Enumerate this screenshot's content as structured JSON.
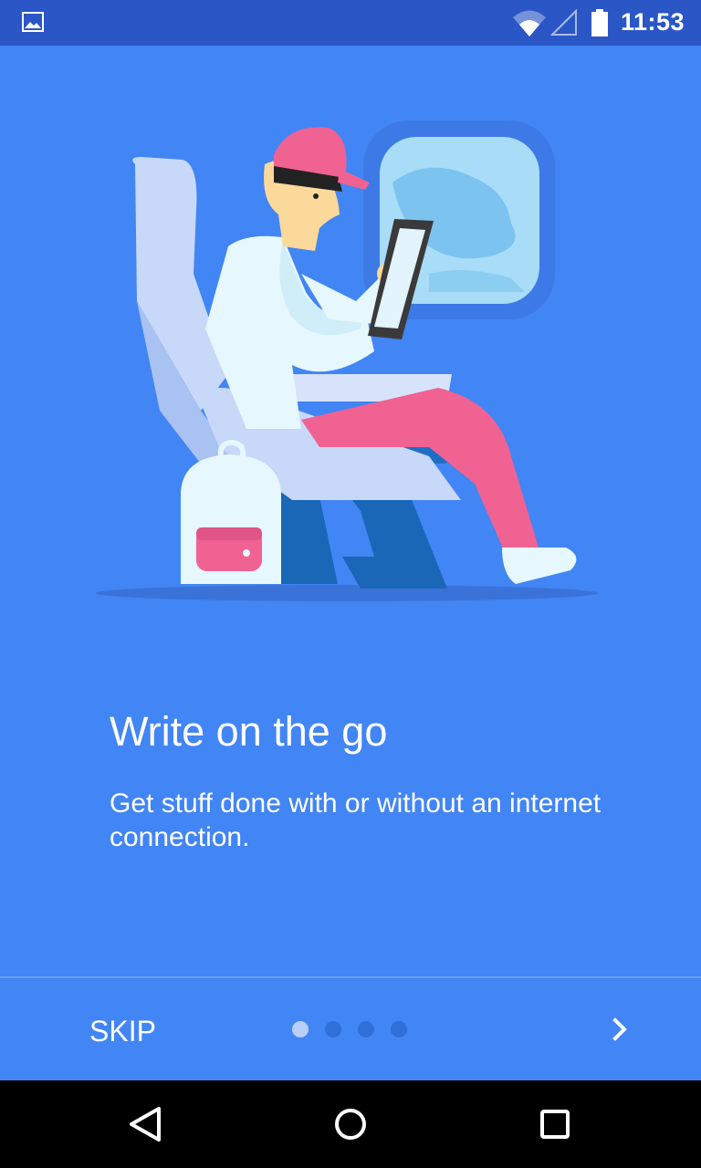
{
  "status_bar": {
    "time": "11:53",
    "icons": [
      "gallery-icon",
      "wifi-icon",
      "cell-signal-icon",
      "battery-icon"
    ]
  },
  "onboarding": {
    "illustration": "man-reading-tablet-on-airplane-seat",
    "title": "Write on the go",
    "description": "Get stuff done with or without an internet connection.",
    "page_count": 4,
    "current_page": 1
  },
  "footer": {
    "skip_label": "SKIP",
    "next_icon": "chevron-right-icon"
  },
  "navigation_bar": {
    "icons": [
      "back-icon",
      "home-icon",
      "recents-icon"
    ]
  },
  "colors": {
    "background": "#4285f4",
    "status_bar": "#2a56c6",
    "dot_active": "#b7cffa",
    "dot_inactive": "#2f6fd8",
    "text": "#ffffff"
  }
}
